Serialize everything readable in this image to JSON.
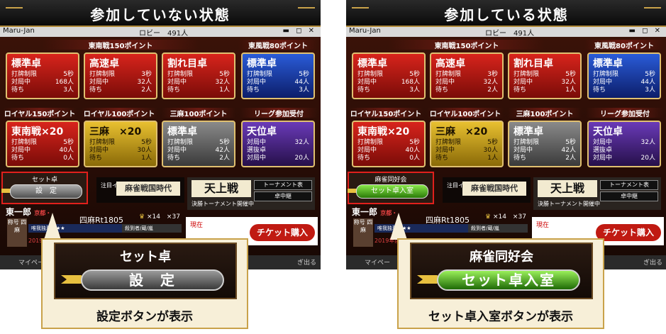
{
  "panels": [
    {
      "banner": "参加していない状態",
      "titlebar": {
        "app": "Maru-Jan",
        "lobby": "ロビー　491人",
        "controls": "▬ ◻ ✕"
      },
      "sections": {
        "tonan": "東南戦150ポイント",
        "tonpu": "東風戦80ポイント",
        "royal150": "ロイヤル150ポイント",
        "royal100": "ロイヤル100ポイント",
        "sanma": "三麻100ポイント",
        "league": "リーグ参加受付"
      },
      "cards_top": [
        {
          "title": "標準卓",
          "r1": [
            "打牌制限",
            "5秒"
          ],
          "r2": [
            "対局中",
            "168人"
          ],
          "r3": [
            "待ち",
            "3人"
          ]
        },
        {
          "title": "高速卓",
          "r1": [
            "打牌制限",
            "3秒"
          ],
          "r2": [
            "対局中",
            "32人"
          ],
          "r3": [
            "待ち",
            "2人"
          ]
        },
        {
          "title": "割れ目卓",
          "r1": [
            "打牌制限",
            "5秒"
          ],
          "r2": [
            "対局中",
            "32人"
          ],
          "r3": [
            "待ち",
            "1人"
          ]
        },
        {
          "title": "標準卓",
          "r1": [
            "打牌制限",
            "5秒"
          ],
          "r2": [
            "対局中",
            "44人"
          ],
          "r3": [
            "待ち",
            "3人"
          ]
        }
      ],
      "cards_mid": [
        {
          "title": "東南戦×20",
          "r1": [
            "打牌制限",
            "5秒"
          ],
          "r2": [
            "対局中",
            "40人"
          ],
          "r3": [
            "待ち",
            "0人"
          ]
        },
        {
          "title": "三麻　×20",
          "r1": [
            "打牌制限",
            "5秒"
          ],
          "r2": [
            "対局中",
            "30人"
          ],
          "r3": [
            "待ち",
            "1人"
          ]
        },
        {
          "title": "標準卓",
          "r1": [
            "打牌制限",
            "5秒"
          ],
          "r2": [
            "対局中",
            "42人"
          ],
          "r3": [
            "待ち",
            "2人"
          ]
        },
        {
          "title": "天位卓",
          "r1": [
            "対局中",
            "32人"
          ],
          "r2": [
            "選抜卓",
            ""
          ],
          "r3": [
            "対局中",
            "20人"
          ]
        }
      ],
      "set": {
        "label": "セット卓",
        "button": "設　定"
      },
      "event": {
        "label": "注目イベント",
        "name": "麻雀戦国時代"
      },
      "tenjo": {
        "title": "天上戦",
        "btn1": "トーナメント表",
        "btn2": "卓中継",
        "note": "決勝トーナメント開催中"
      },
      "player": {
        "name": "東一郎",
        "region": "京都・",
        "rate": "四麻Rt1805",
        "trophies": "×14　×37"
      },
      "medal": "称号 四麻",
      "strip": "唯我独尊の★★",
      "strip2": "殺到者/蔵/嵐",
      "year": "2019年度",
      "ticket": {
        "now": "現在",
        "buy": "チケット購入"
      },
      "bottom": {
        "mypage": "マイペー",
        "right": "ぎ出る"
      },
      "zoom": {
        "title": "セット卓",
        "button": "設　定",
        "caption": "設定ボタンが表示"
      }
    },
    {
      "banner": "参加している状態",
      "titlebar": {
        "app": "Maru-Jan",
        "lobby": "ロビー　491人",
        "controls": "▬ ◻ ✕"
      },
      "sections": {
        "tonan": "東南戦150ポイント",
        "tonpu": "東風戦80ポイント",
        "royal150": "ロイヤル150ポイント",
        "royal100": "ロイヤル100ポイント",
        "sanma": "三麻100ポイント",
        "league": "リーグ参加受付"
      },
      "cards_top": [
        {
          "title": "標準卓",
          "r1": [
            "打牌制限",
            "5秒"
          ],
          "r2": [
            "対局中",
            "168人"
          ],
          "r3": [
            "待ち",
            "3人"
          ]
        },
        {
          "title": "高速卓",
          "r1": [
            "打牌制限",
            "3秒"
          ],
          "r2": [
            "対局中",
            "32人"
          ],
          "r3": [
            "待ち",
            "2人"
          ]
        },
        {
          "title": "割れ目卓",
          "r1": [
            "打牌制限",
            "5秒"
          ],
          "r2": [
            "対局中",
            "32人"
          ],
          "r3": [
            "待ち",
            "1人"
          ]
        },
        {
          "title": "標準卓",
          "r1": [
            "打牌制限",
            "5秒"
          ],
          "r2": [
            "対局中",
            "44人"
          ],
          "r3": [
            "待ち",
            "3人"
          ]
        }
      ],
      "cards_mid": [
        {
          "title": "東南戦×20",
          "r1": [
            "打牌制限",
            "5秒"
          ],
          "r2": [
            "対局中",
            "40人"
          ],
          "r3": [
            "待ち",
            "0人"
          ]
        },
        {
          "title": "三麻　×20",
          "r1": [
            "打牌制限",
            "5秒"
          ],
          "r2": [
            "対局中",
            "30人"
          ],
          "r3": [
            "待ち",
            "1人"
          ]
        },
        {
          "title": "標準卓",
          "r1": [
            "打牌制限",
            "5秒"
          ],
          "r2": [
            "対局中",
            "42人"
          ],
          "r3": [
            "待ち",
            "2人"
          ]
        },
        {
          "title": "天位卓",
          "r1": [
            "対局中",
            "32人"
          ],
          "r2": [
            "選抜卓",
            ""
          ],
          "r3": [
            "対局中",
            "20人"
          ]
        }
      ],
      "set": {
        "label": "麻雀同好会",
        "button": "セット卓入室"
      },
      "event": {
        "label": "注目イベント",
        "name": "麻雀戦国時代"
      },
      "tenjo": {
        "title": "天上戦",
        "btn1": "トーナメント表",
        "btn2": "卓中継",
        "note": "決勝トーナメント開催中"
      },
      "player": {
        "name": "東一郎",
        "region": "京都・",
        "rate": "四麻Rt1805",
        "trophies": "×14　×37"
      },
      "medal": "称号 四麻",
      "strip": "唯我独尊の★★",
      "strip2": "殺到者/蔵/嵐",
      "year": "2019年度",
      "ticket": {
        "now": "現在",
        "buy": "チケット購入"
      },
      "bottom": {
        "mypage": "マイペー",
        "right": "ぎ出る"
      },
      "zoom": {
        "title": "麻雀同好会",
        "button": "セット卓入室",
        "caption": "セット卓入室ボタンが表示"
      }
    }
  ]
}
